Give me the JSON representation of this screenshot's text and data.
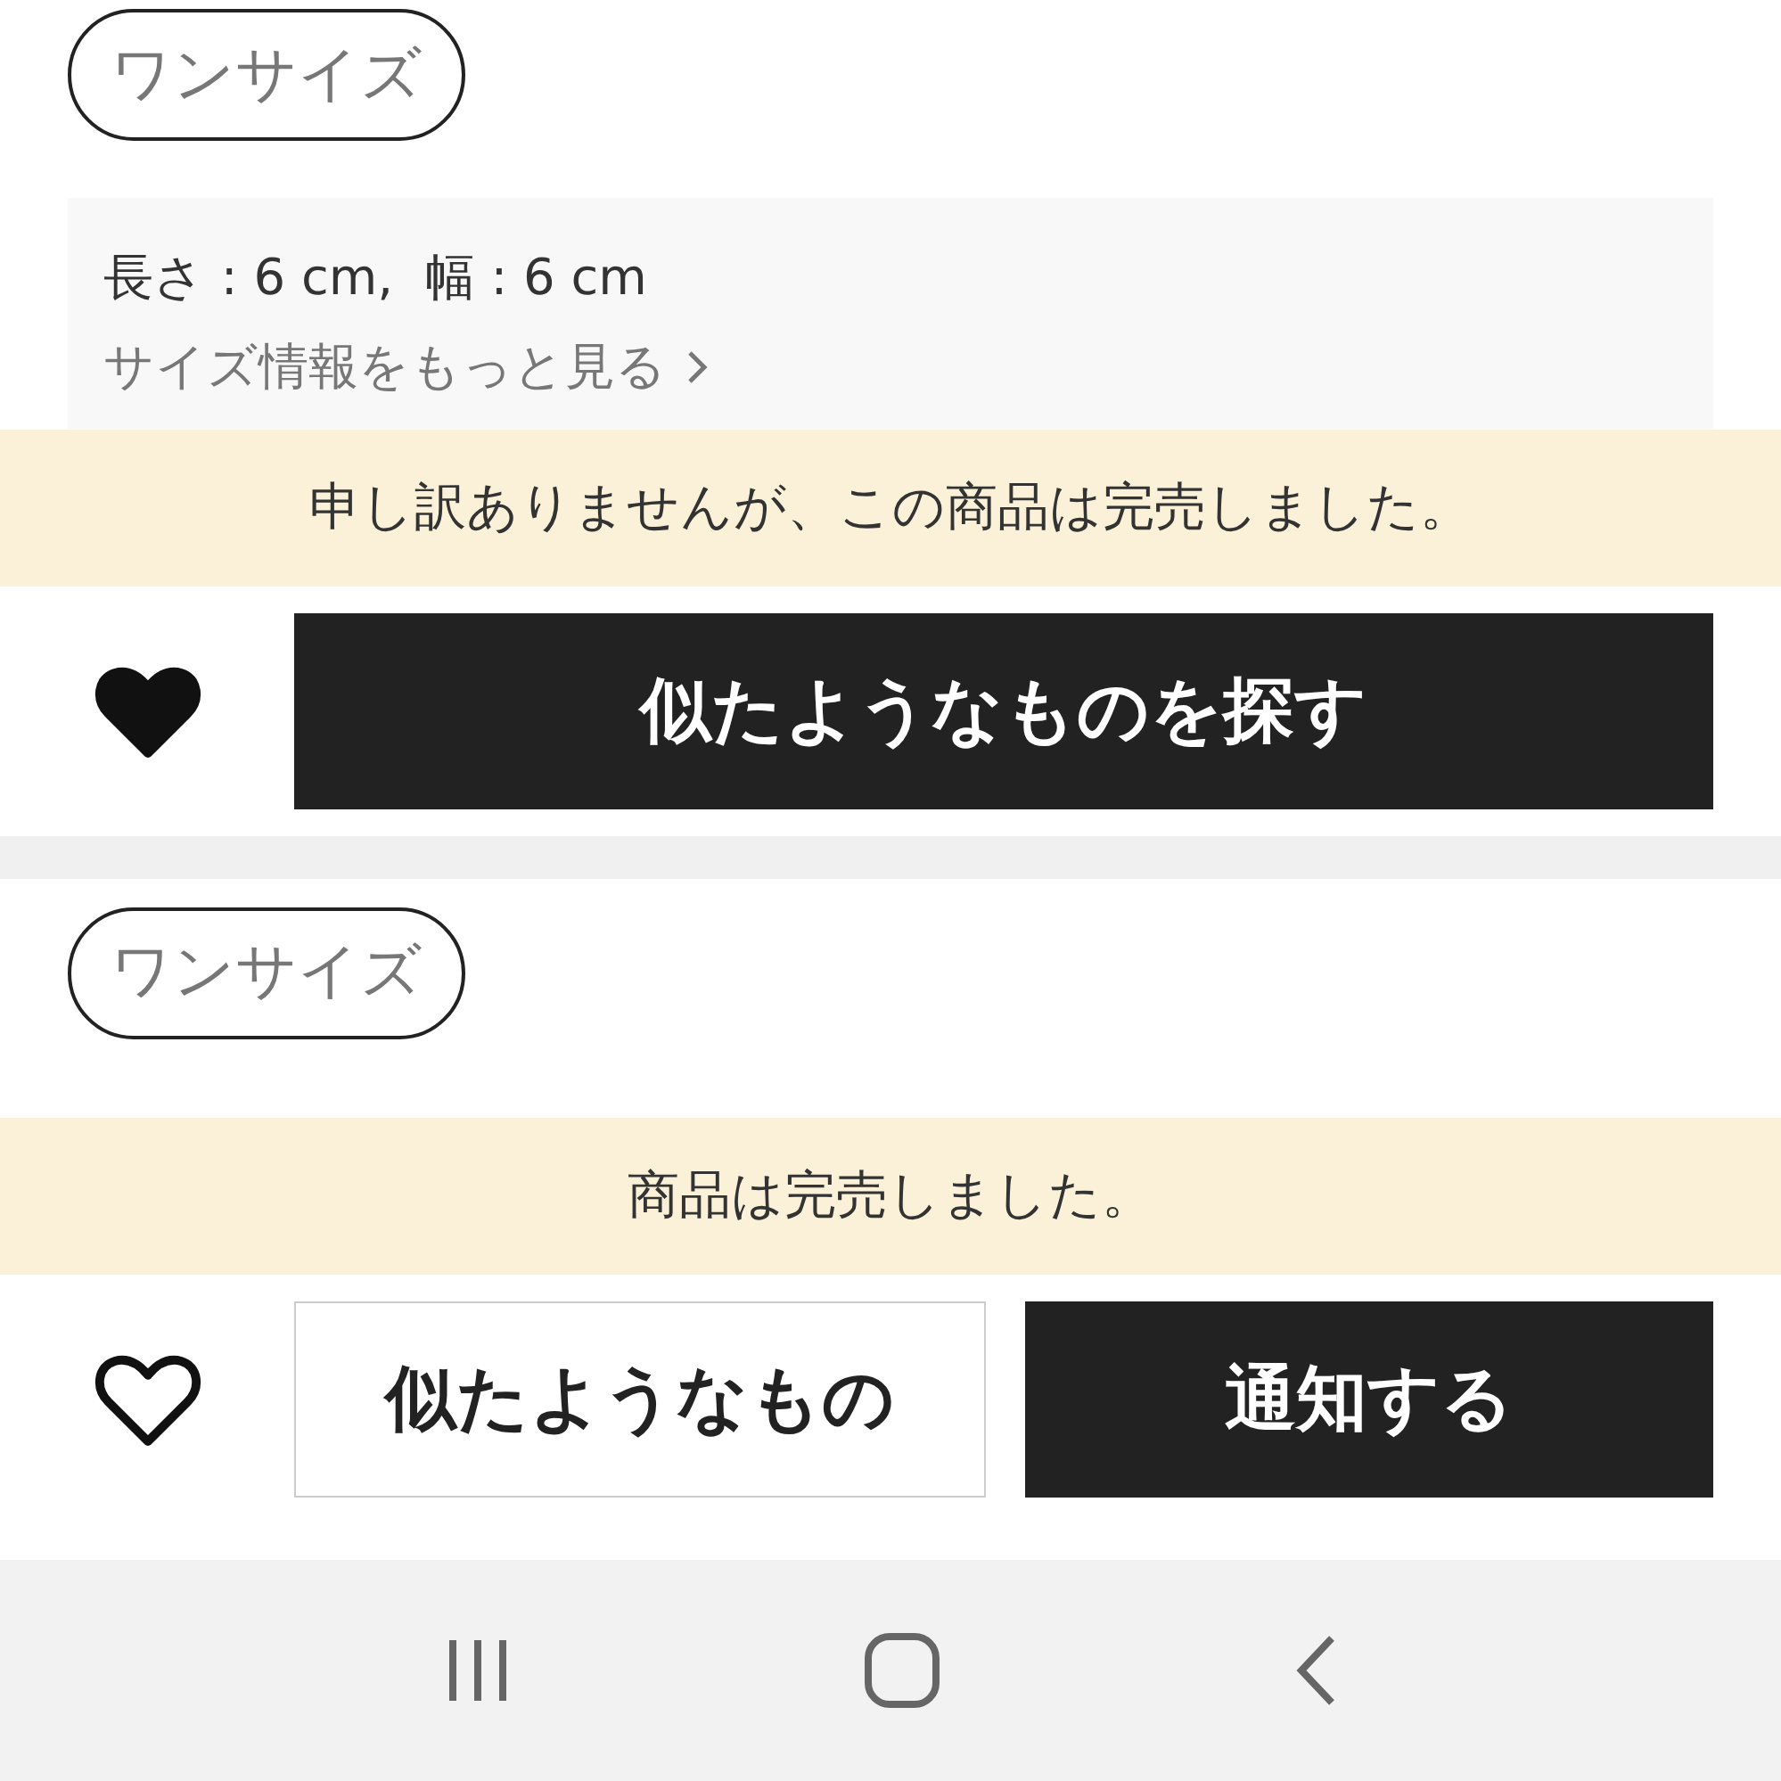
{
  "sections": [
    {
      "size_chip": "ワンサイズ",
      "size_info": {
        "dimensions": "長さ : 6 cm,  幅 : 6 cm",
        "more_link": "サイズ情報をもっと見る"
      },
      "notice": "申し訳ありませんが、この商品は完売しました。",
      "favorite": {
        "selected": true
      },
      "buttons": [
        {
          "label": "似たようなものを探す",
          "kind": "primary"
        }
      ]
    },
    {
      "size_chip": "ワンサイズ",
      "notice": "商品は完売しました。",
      "favorite": {
        "selected": false
      },
      "buttons": [
        {
          "label": "似たようなもの",
          "kind": "secondary"
        },
        {
          "label": "通知する",
          "kind": "primary"
        }
      ]
    }
  ]
}
